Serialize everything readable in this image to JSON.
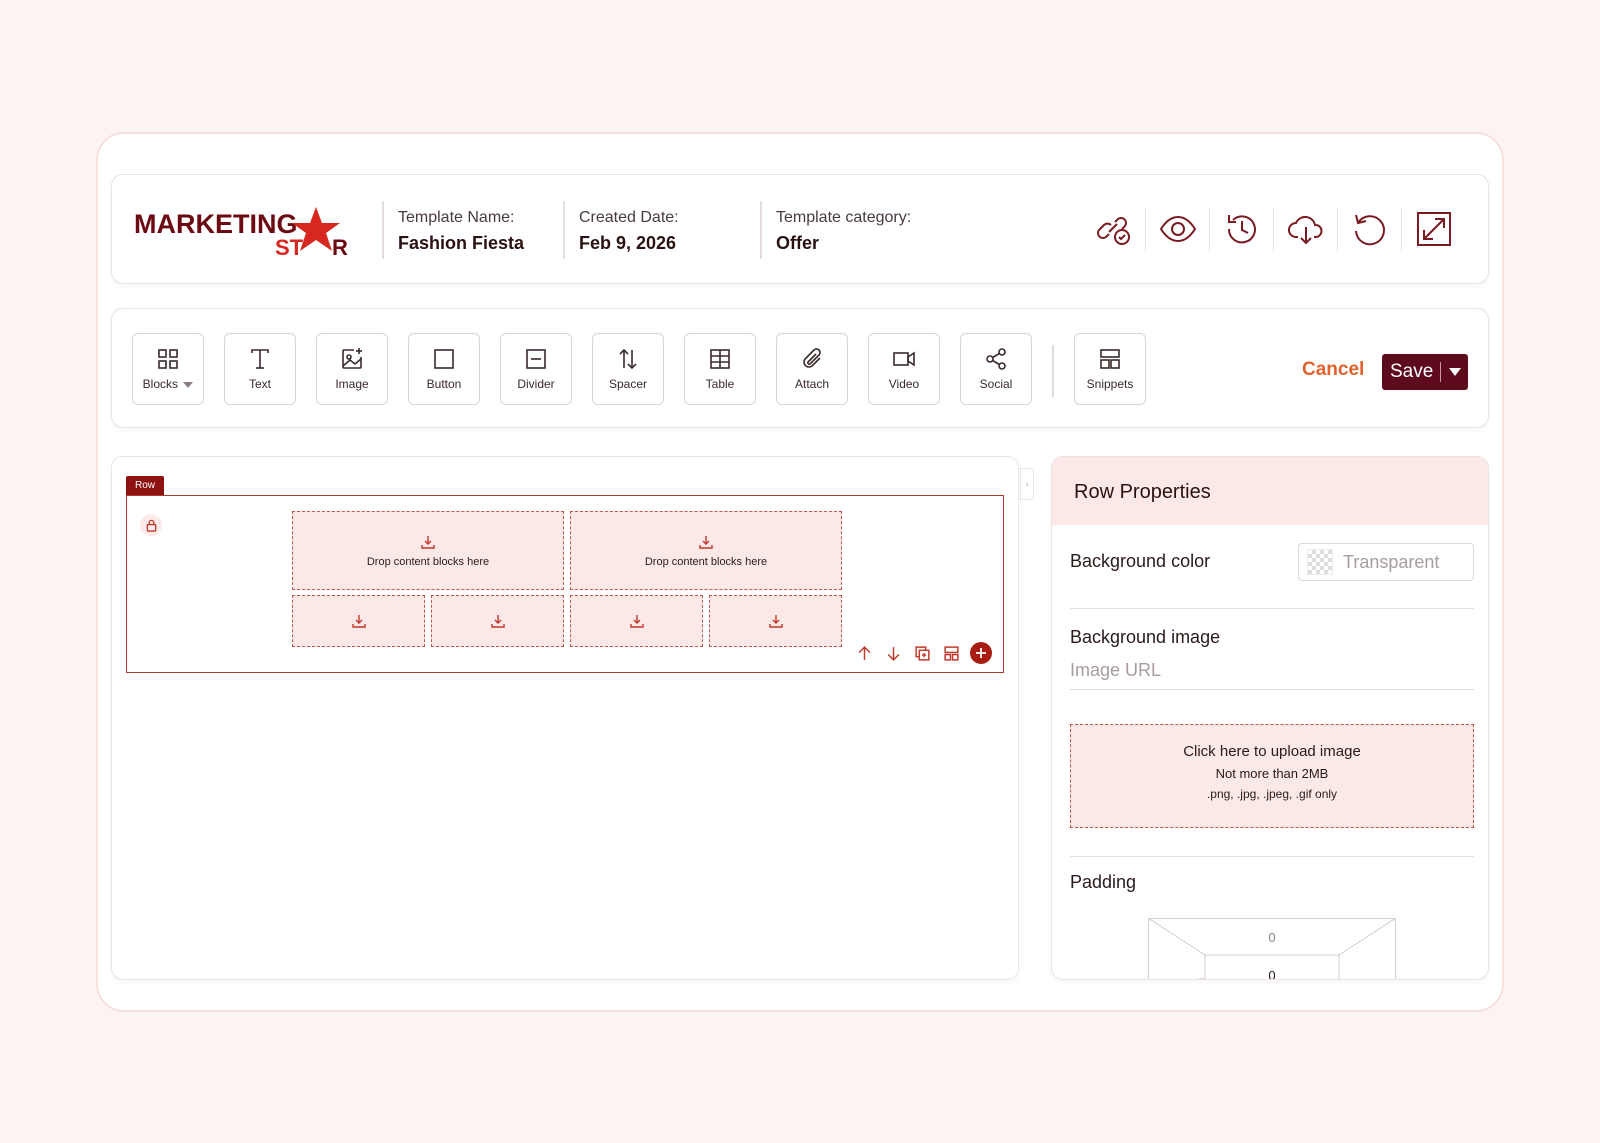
{
  "colors": {
    "brand_dark": "#5c0a1c",
    "accent_orange": "#e0622d",
    "drop_fill": "#fde8e8",
    "row_border": "#b03a2e",
    "page_bg": "#fcf3f2"
  },
  "header": {
    "logo_text_top": "MARKETING",
    "logo_text_bottom_left": "ST",
    "logo_text_bottom_right": "R",
    "template_name_label": "Template Name:",
    "template_name_value": "Fashion Fiesta",
    "created_label": "Created Date:",
    "created_value": "Feb 9, 2026",
    "category_label": "Template category:",
    "category_value": "Offer",
    "icons": [
      "link-check-icon",
      "eye-icon",
      "history-icon",
      "cloud-download-icon",
      "reset-icon",
      "expand-icon"
    ]
  },
  "toolbar": {
    "tools": [
      {
        "label": "Blocks",
        "icon": "grid-icon"
      },
      {
        "label": "Text",
        "icon": "text-icon"
      },
      {
        "label": "Image",
        "icon": "image-add-icon"
      },
      {
        "label": "Button",
        "icon": "button-icon"
      },
      {
        "label": "Divider",
        "icon": "divider-icon"
      },
      {
        "label": "Spacer",
        "icon": "spacer-icon"
      },
      {
        "label": "Table",
        "icon": "table-icon"
      },
      {
        "label": "Attach",
        "icon": "paperclip-icon"
      },
      {
        "label": "Video",
        "icon": "video-icon"
      },
      {
        "label": "Social",
        "icon": "share-icon"
      },
      {
        "label": "Snippets",
        "icon": "snippets-icon"
      }
    ],
    "cancel_label": "Cancel",
    "save_label": "Save"
  },
  "canvas": {
    "row_tag": "Row",
    "drop_label": "Drop content blocks here",
    "row_action_icons": [
      "arrow-up-icon",
      "arrow-down-icon",
      "duplicate-icon",
      "layout-icon",
      "add-icon"
    ]
  },
  "properties": {
    "title": "Row Properties",
    "background_color_label": "Background color",
    "background_color_value": "Transparent",
    "background_image_label": "Background image",
    "image_url_placeholder": "Image URL",
    "upload_line1": "Click here to upload image",
    "upload_line2": "Not more than 2MB",
    "upload_line3": ".png, .jpg, .jpeg, .gif only",
    "padding_label": "Padding",
    "padding_outer_top": "0",
    "padding_inner_top": "0"
  }
}
